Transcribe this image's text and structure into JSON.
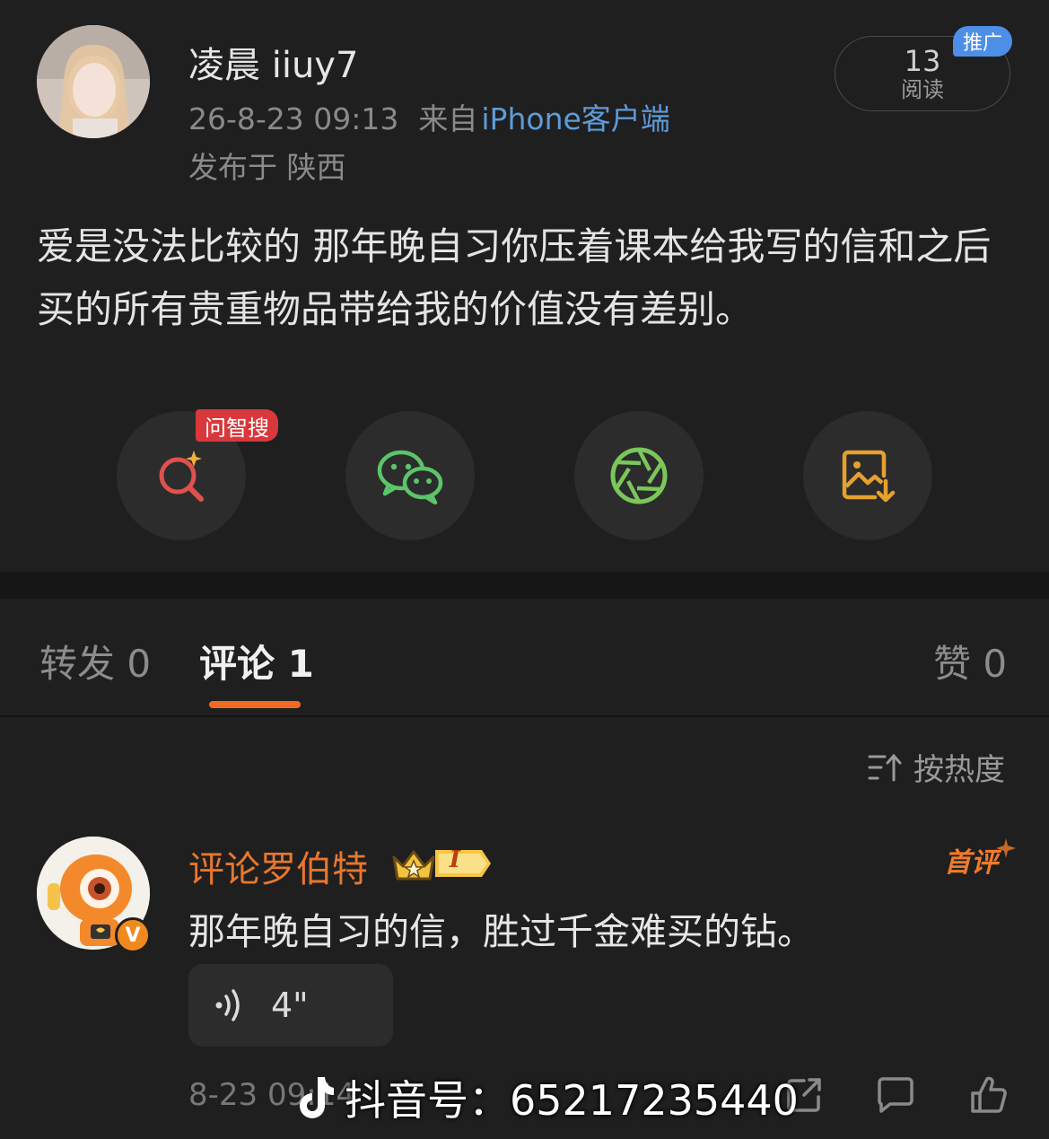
{
  "post": {
    "username": "凌晨 iiuy7",
    "time": "26-8-23 09:13",
    "source_prefix": "来自",
    "source": "iPhone客户端",
    "location": "发布于 陕西",
    "read_count": "13",
    "read_label": "阅读",
    "promo_badge": "推广",
    "content": "爱是没法比较的 那年晚自习你压着课本给我写的信和之后买的所有贵重物品带给我的价值没有差别。"
  },
  "share": {
    "ask_badge": "问智搜",
    "buttons": [
      {
        "icon": "ai-search-icon",
        "color": "#e0504c"
      },
      {
        "icon": "wechat-icon",
        "color": "#5cc46a"
      },
      {
        "icon": "moments-icon",
        "color": "#7ac75a"
      },
      {
        "icon": "save-image-icon",
        "color": "#e6a030"
      }
    ]
  },
  "tabs": {
    "repost": "转发 0",
    "comment": "评论 1",
    "like": "赞 0",
    "active_color": "#f06a24"
  },
  "sort_label": "按热度",
  "comment": {
    "author": "评论罗伯特",
    "level_badge": "I",
    "first_badge": "首评",
    "vip_badge": "V",
    "text": "那年晚自习的信，胜过千金难买的钻。",
    "voice_duration": "4\"",
    "time": "8-23 09:14"
  },
  "watermark": {
    "text": "抖音号：65217235440"
  }
}
